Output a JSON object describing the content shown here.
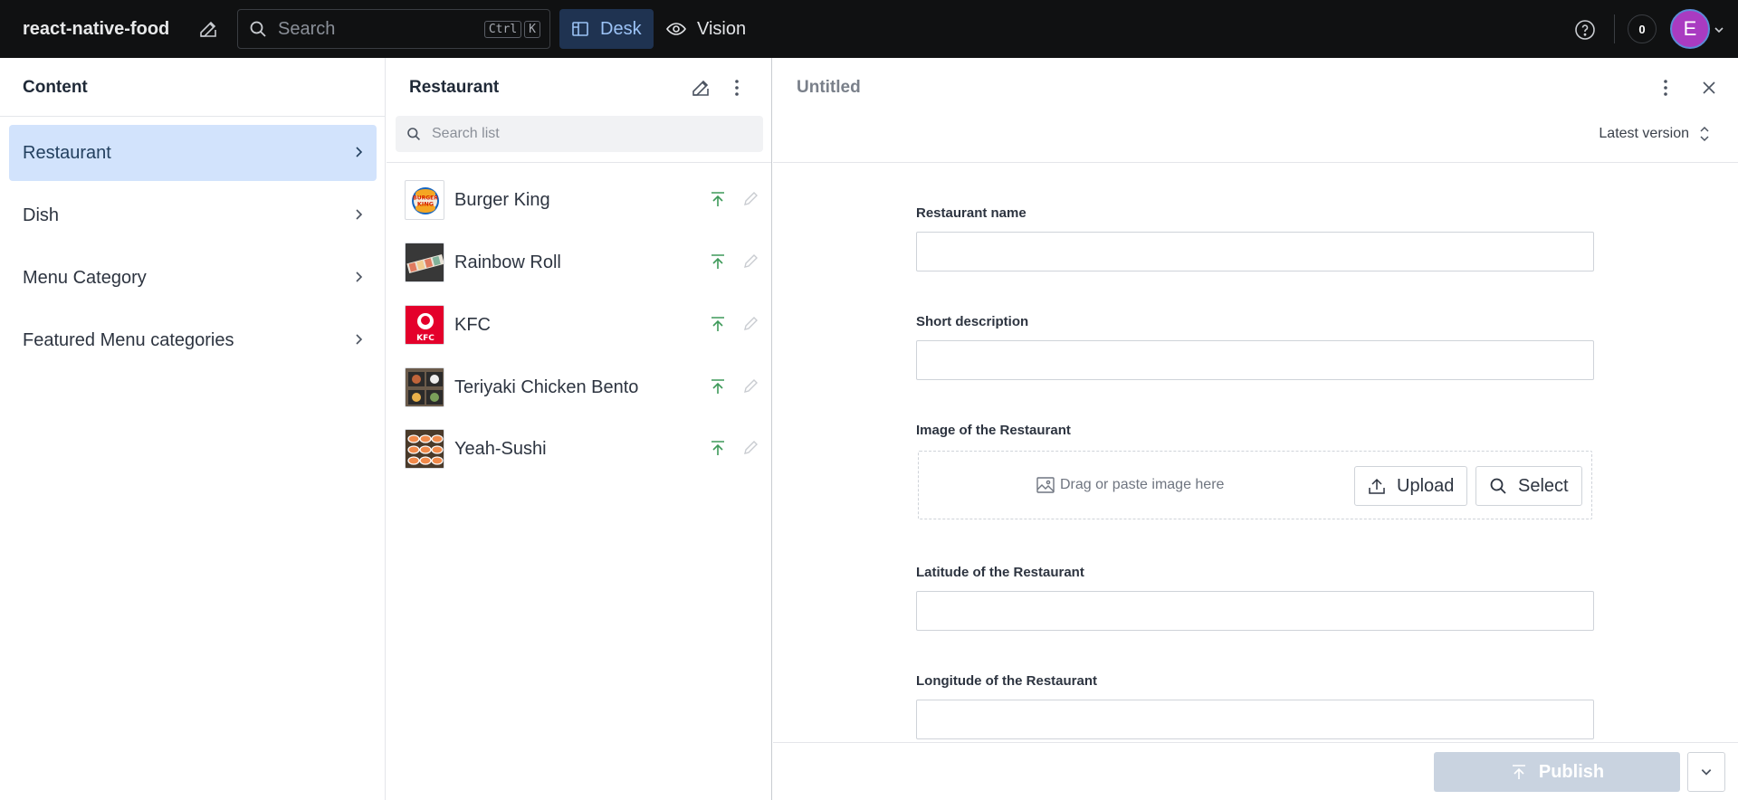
{
  "topbar": {
    "project_name": "react-native-food",
    "search_placeholder": "Search",
    "kbd_ctrl": "Ctrl",
    "kbd_k": "K",
    "tools": [
      {
        "label": "Desk",
        "active": true
      },
      {
        "label": "Vision",
        "active": false
      }
    ],
    "notification_count": "0",
    "avatar_initial": "E"
  },
  "content_pane": {
    "title": "Content",
    "items": [
      {
        "label": "Restaurant",
        "selected": true
      },
      {
        "label": "Dish",
        "selected": false
      },
      {
        "label": "Menu Category",
        "selected": false
      },
      {
        "label": "Featured Menu categories",
        "selected": false
      }
    ]
  },
  "list_pane": {
    "title": "Restaurant",
    "search_placeholder": "Search list",
    "items": [
      {
        "name": "Burger King",
        "thumb": "burger-king-logo"
      },
      {
        "name": "Rainbow Roll",
        "thumb": "sushi-roll-photo"
      },
      {
        "name": "KFC",
        "thumb": "kfc-logo"
      },
      {
        "name": "Teriyaki Chicken Bento",
        "thumb": "bento-photo"
      },
      {
        "name": "Yeah-Sushi",
        "thumb": "sushi-photo"
      }
    ]
  },
  "document_pane": {
    "title": "Untitled",
    "version_label": "Latest version",
    "fields": [
      {
        "label": "Restaurant name",
        "value": ""
      },
      {
        "label": "Short description",
        "value": ""
      },
      {
        "label": "Image of the Restaurant"
      },
      {
        "label": "Latitude of the Restaurant",
        "value": ""
      },
      {
        "label": "Longitude of the Restaurant",
        "value": ""
      }
    ],
    "image_hint": "Drag or paste image here",
    "upload_label": "Upload",
    "select_label": "Select",
    "publish_label": "Publish"
  },
  "colors": {
    "topbar_bg": "#101112",
    "active_tool_bg": "#1f3351",
    "selected_item_bg": "#d2e3fc",
    "publish_green": "#3e9a5a",
    "avatar_bg": "#a93bc1"
  }
}
